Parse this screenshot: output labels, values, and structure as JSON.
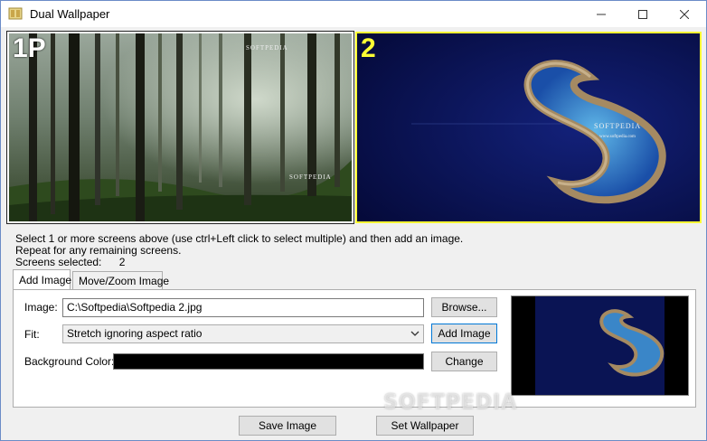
{
  "window": {
    "title": "Dual Wallpaper"
  },
  "screens": [
    {
      "label": "1P",
      "watermark_top": "SOFTPEDIA",
      "watermark_bottom": "SOFTPEDIA",
      "selected": true
    },
    {
      "label": "2",
      "watermark": "SOFTPEDIA",
      "watermark_url": "www.softpedia.com",
      "selected": true
    }
  ],
  "instructions": {
    "line1": "Select 1 or more screens above (use ctrl+Left click to select multiple) and then add an image.",
    "line2": "Repeat for any remaining screens.",
    "screens_selected_label": "Screens selected:",
    "screens_selected_value": "2"
  },
  "tabs": [
    {
      "label": "Add Image",
      "active": true
    },
    {
      "label": "Move/Zoom Image",
      "active": false
    }
  ],
  "form": {
    "image_label": "Image:",
    "image_value": "C:\\Softpedia\\Softpedia 2.jpg",
    "browse_button": "Browse...",
    "fit_label": "Fit:",
    "fit_value": "Stretch ignoring aspect ratio",
    "add_image_button": "Add Image",
    "bg_color_label": "Background Color:",
    "bg_color_value": "#000000",
    "change_button": "Change"
  },
  "footer": {
    "save_image_button": "Save Image",
    "set_wallpaper_button": "Set Wallpaper"
  },
  "watermark": "SOFTPEDIA",
  "colors": {
    "selection_border": "#ffff33",
    "accent_focus": "#0078d7"
  }
}
